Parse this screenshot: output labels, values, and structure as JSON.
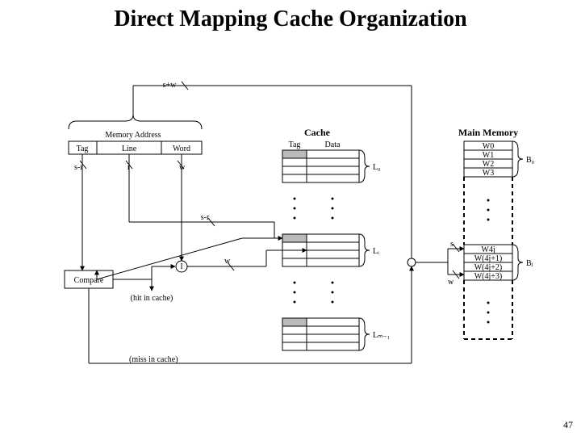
{
  "title": "Direct Mapping Cache Organization",
  "page_number": "47",
  "labels": {
    "sw": "s+w",
    "memory_address": "Memory Address",
    "tag": "Tag",
    "line": "Line",
    "word": "Word",
    "s_minus_r": "s-r",
    "r": "r",
    "w": "w",
    "cache": "Cache",
    "cache_tag": "Tag",
    "cache_data": "Data",
    "L0": "L₀",
    "Li": "Lᵢ",
    "Lm1": "Lₘ₋₁",
    "main_memory": "Main Memory",
    "W0": "W0",
    "W1": "W1",
    "W2": "W2",
    "W3": "W3",
    "W4j": "W4j",
    "W4j1": "W(4j+1)",
    "W4j2": "W(4j+2)",
    "W4j3": "W(4j+3)",
    "B0": "B₀",
    "Bj": "Bⱼ",
    "s": "s",
    "compare": "Compare",
    "hit": "(hit in cache)",
    "miss": "(miss in cache)"
  }
}
